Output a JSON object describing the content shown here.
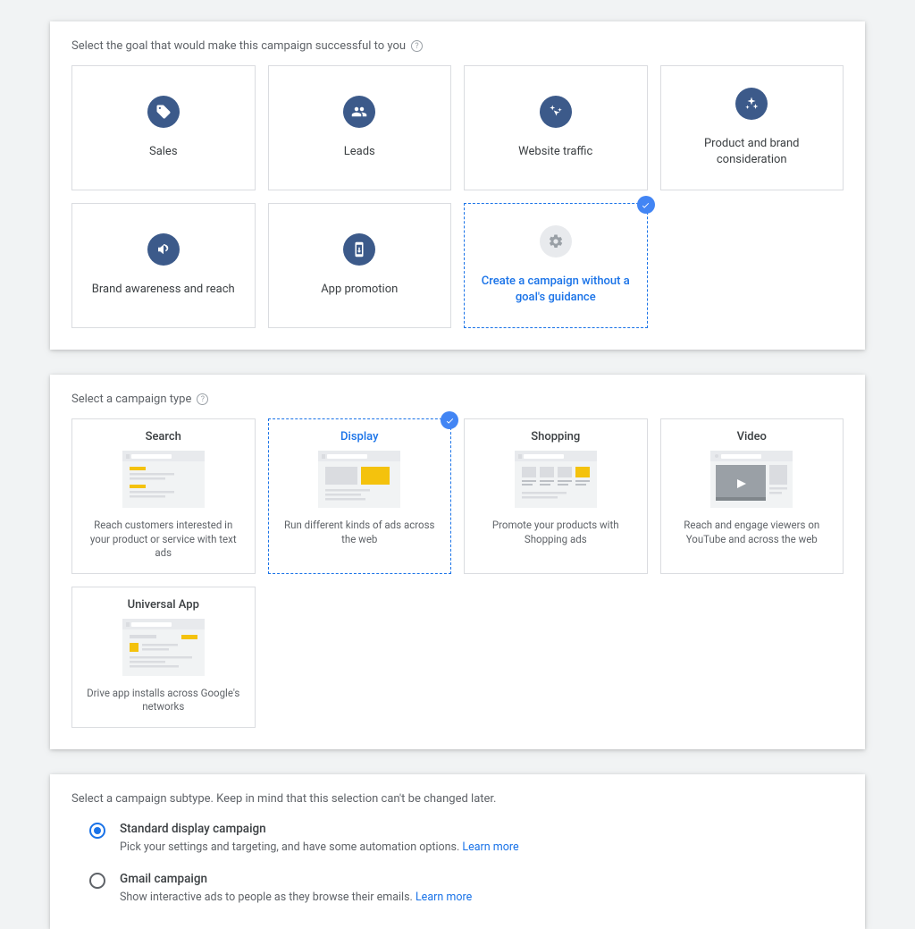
{
  "goals": {
    "title": "Select the goal that would make this campaign successful to you",
    "items": [
      {
        "label": "Sales"
      },
      {
        "label": "Leads"
      },
      {
        "label": "Website traffic"
      },
      {
        "label": "Product and brand consideration"
      },
      {
        "label": "Brand awareness and reach"
      },
      {
        "label": "App promotion"
      },
      {
        "label": "Create a campaign without a goal's guidance"
      }
    ]
  },
  "types": {
    "title": "Select a campaign type",
    "items": [
      {
        "title": "Search",
        "desc": "Reach customers interested in your product or service with text ads"
      },
      {
        "title": "Display",
        "desc": "Run different kinds of ads across the web"
      },
      {
        "title": "Shopping",
        "desc": "Promote your products with Shopping ads"
      },
      {
        "title": "Video",
        "desc": "Reach and engage viewers on YouTube and across the web"
      },
      {
        "title": "Universal App",
        "desc": "Drive app installs across Google's networks"
      }
    ]
  },
  "subtype": {
    "title": "Select a campaign subtype. Keep in mind that this selection can't be changed later.",
    "options": [
      {
        "title": "Standard display campaign",
        "desc": "Pick your settings and targeting, and have some automation options. ",
        "link": "Learn more"
      },
      {
        "title": "Gmail campaign",
        "desc": "Show interactive ads to people as they browse their emails. ",
        "link": "Learn more"
      }
    ]
  }
}
